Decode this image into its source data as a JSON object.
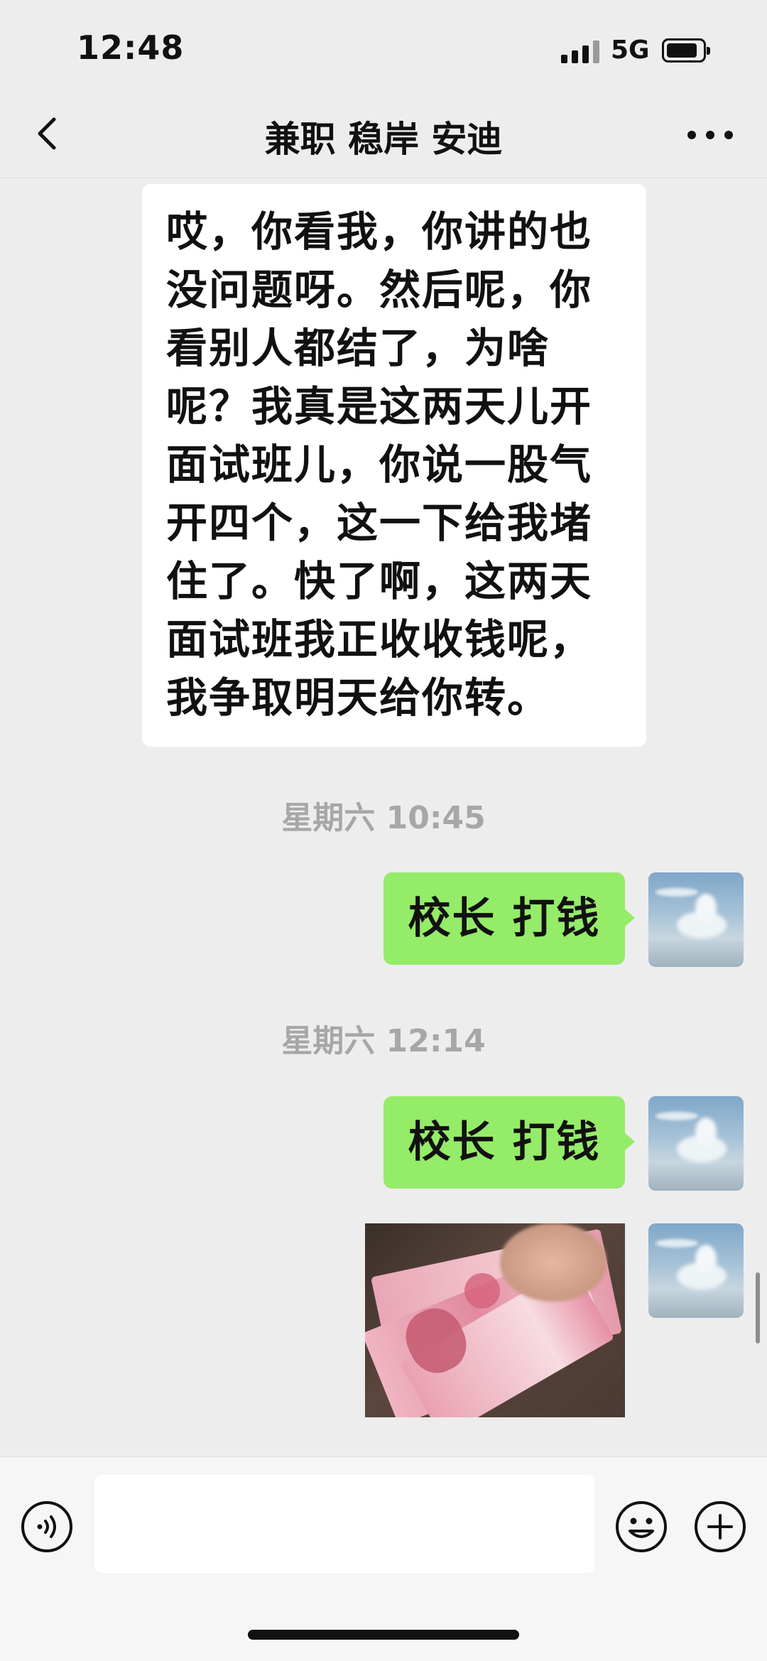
{
  "status_bar": {
    "time": "12:48",
    "network": "5G",
    "battery_level": 0.85,
    "signal_icon": "signal-bars-icon",
    "battery_icon": "battery-icon"
  },
  "nav": {
    "title": "兼职 稳岸 安迪",
    "back_icon": "chevron-left-icon",
    "more_icon": "more-horizontal-icon"
  },
  "messages": [
    {
      "side": "left",
      "type": "text",
      "text": "哎，你看我，你讲的也没问题呀。然后呢，你看别人都结了，为啥呢？我真是这两天儿开面试班儿，你说一股气开四个，这一下给我堵住了。快了啊，这两天面试班我正收收钱呢，我争取明天给你转。"
    },
    {
      "type": "timestamp",
      "text": "星期六 10:45"
    },
    {
      "side": "right",
      "type": "text",
      "text": "校长 打钱"
    },
    {
      "type": "timestamp",
      "text": "星期六 12:14"
    },
    {
      "side": "right",
      "type": "text",
      "text": "校长 打钱"
    },
    {
      "side": "right",
      "type": "image",
      "image": "banknotes-photo"
    }
  ],
  "input_bar": {
    "voice_icon": "voice-icon",
    "emoji_icon": "emoji-icon",
    "plus_icon": "plus-icon",
    "input_value": ""
  },
  "colors": {
    "background": "#ededed",
    "sent_bubble": "#95ec69",
    "received_bubble": "#ffffff",
    "timestamp": "#a7a7a7"
  }
}
